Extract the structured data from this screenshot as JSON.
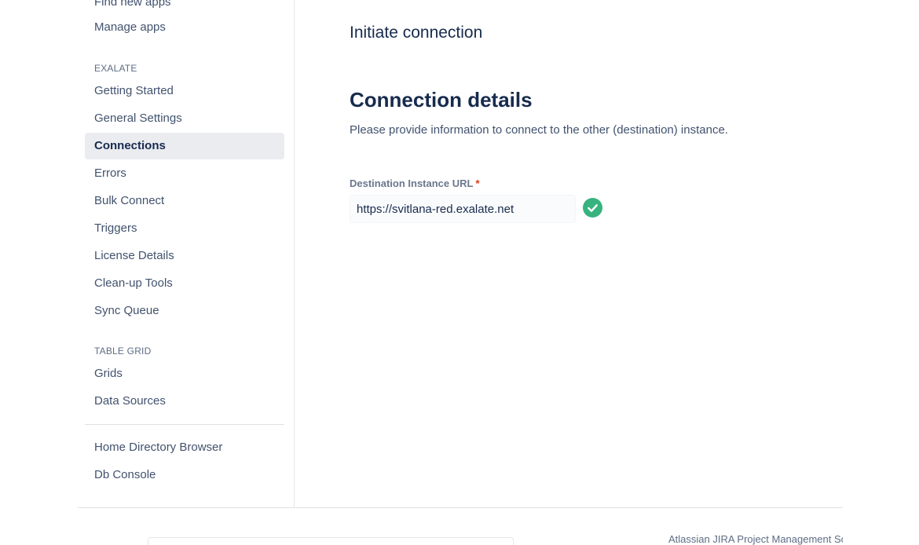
{
  "sidebar": {
    "top_items": [
      {
        "label": "Find new apps"
      },
      {
        "label": "Manage apps"
      }
    ],
    "sections": [
      {
        "title": "EXALATE",
        "items": [
          {
            "label": "Getting Started"
          },
          {
            "label": "General Settings"
          },
          {
            "label": "Connections",
            "active": true
          },
          {
            "label": "Errors"
          },
          {
            "label": "Bulk Connect"
          },
          {
            "label": "Triggers"
          },
          {
            "label": "License Details"
          },
          {
            "label": "Clean-up Tools"
          },
          {
            "label": "Sync Queue"
          }
        ]
      },
      {
        "title": "TABLE GRID",
        "items": [
          {
            "label": "Grids"
          },
          {
            "label": "Data Sources"
          }
        ]
      }
    ],
    "bottom_items": [
      {
        "label": "Home Directory Browser"
      },
      {
        "label": "Db Console"
      }
    ]
  },
  "main": {
    "title": "Initiate connection",
    "heading": "Connection details",
    "description": "Please provide information to connect to the other (destination) instance.",
    "field": {
      "label": "Destination Instance URL",
      "required_mark": "*",
      "value": "https://svitlana-red.exalate.net",
      "status_icon": "check-circle-icon",
      "status_color": "#36b37e"
    }
  },
  "footer": {
    "text": "Atlassian JIRA Project Management Software"
  }
}
